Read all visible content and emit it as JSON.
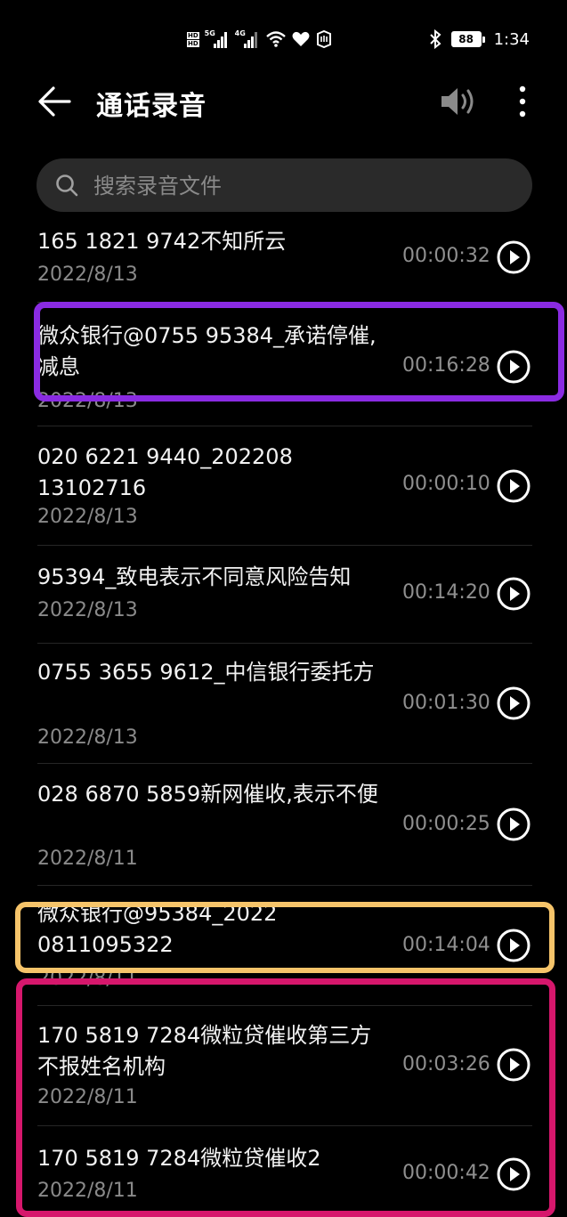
{
  "status_bar": {
    "hd1": "HD",
    "hd2": "HD",
    "net1": "5G",
    "net2": "4G",
    "battery": "88",
    "time": "1:34"
  },
  "header": {
    "title": "通话录音",
    "back_icon": "arrow-left-icon",
    "speaker_icon": "speaker-icon",
    "more_icon": "more-vertical-icon"
  },
  "search": {
    "placeholder": "搜索录音文件",
    "icon": "search-icon"
  },
  "recordings": [
    {
      "name": "165 1821 9742不知所云",
      "date": "2022/8/13",
      "duration": "00:00:32"
    },
    {
      "name": "微众银行@0755 95384_承诺停催,减息",
      "date": "2022/8/13",
      "duration": "00:16:28"
    },
    {
      "name": "020 6221 9440_20220813102716",
      "date": "2022/8/13",
      "duration": "00:00:10"
    },
    {
      "name": "95394_致电表示不同意风险告知",
      "date": "2022/8/13",
      "duration": "00:14:20"
    },
    {
      "name": "0755 3655 9612_中信银行委托方",
      "date": "2022/8/13",
      "duration": "00:01:30"
    },
    {
      "name": "028 6870 5859新网催收,表示不便",
      "date": "2022/8/11",
      "duration": "00:00:25"
    },
    {
      "name": "微众银行@95384_20220811095322",
      "date": "2022/8/11",
      "duration": "00:14:04"
    },
    {
      "name": "170 5819 7284微粒贷催收第三方不报姓名机构",
      "date": "2022/8/11",
      "duration": "00:03:26"
    },
    {
      "name": "170 5819 7284微粒贷催收2",
      "date": "2022/8/11",
      "duration": "00:00:42"
    }
  ],
  "colors": {
    "background": "#000000",
    "highlight_purple": "#8a2be2",
    "highlight_orange": "#f6c46a",
    "highlight_magenta": "#d6176c"
  }
}
